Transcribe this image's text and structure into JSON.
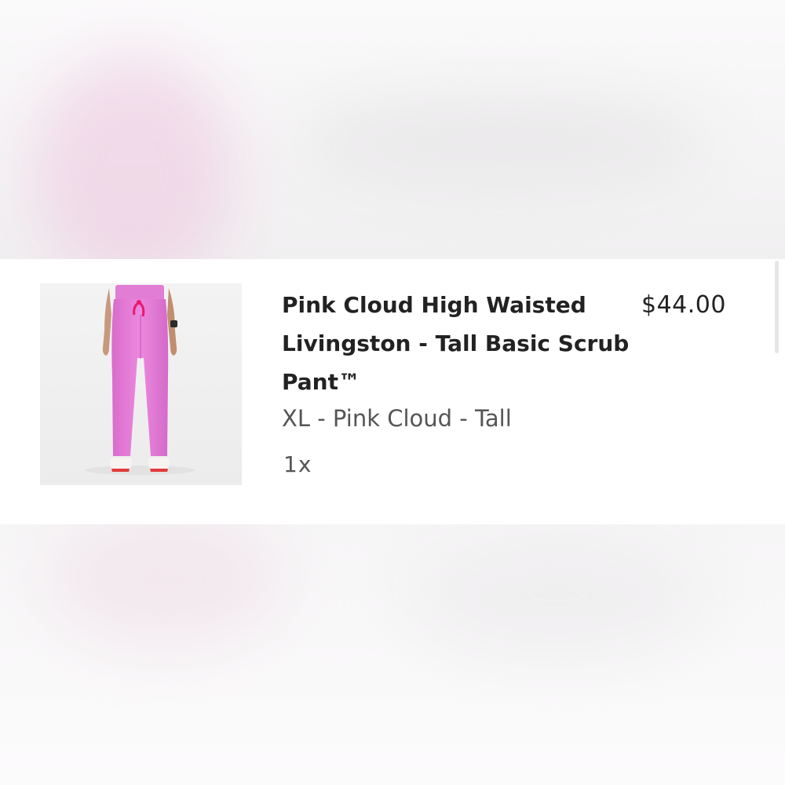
{
  "cart_item": {
    "product_image_icon": "pink-scrub-pant-photo",
    "title": "Pink Cloud High Waisted Livingston - Tall Basic Scrub Pant™",
    "price": "$44.00",
    "variant": "XL - Pink Cloud - Tall",
    "quantity": "1x"
  },
  "colors": {
    "product_pink": "#e77fd9",
    "drawstring": "#e51c6e",
    "text_primary": "#222222",
    "text_secondary": "#555555"
  }
}
